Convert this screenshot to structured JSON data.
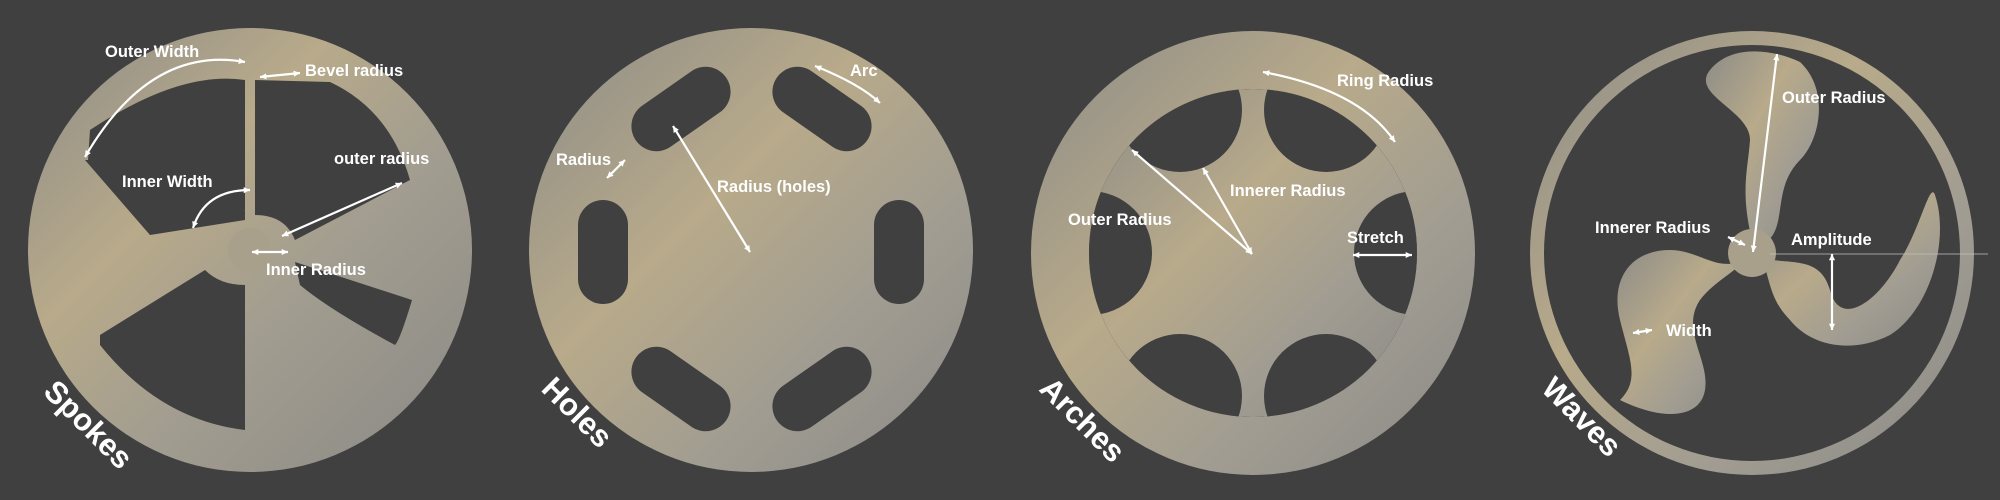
{
  "panels": {
    "spokes": {
      "title": "Spokes",
      "labels": {
        "outer_width": "Outer Width",
        "bevel_radius": "Bevel radius",
        "inner_width": "Inner Width",
        "outer_radius": "outer radius",
        "inner_radius": "Inner Radius"
      }
    },
    "holes": {
      "title": "Holes",
      "labels": {
        "arc": "Arc",
        "radius": "Radius",
        "radius_holes": "Radius (holes)"
      }
    },
    "arches": {
      "title": "Arches",
      "labels": {
        "ring_radius": "Ring Radius",
        "innerer_radius": "Innerer Radius",
        "outer_radius": "Outer Radius",
        "stretch": "Stretch"
      }
    },
    "waves": {
      "title": "Waves",
      "labels": {
        "outer_radius": "Outer Radius",
        "innerer_radius": "Innerer Radius",
        "amplitude": "Amplitude",
        "width": "Width"
      }
    }
  },
  "colors": {
    "background": "#404040",
    "metal_light": "#b9ab8c",
    "metal_mid": "#9a9891",
    "label": "#ffffff"
  }
}
